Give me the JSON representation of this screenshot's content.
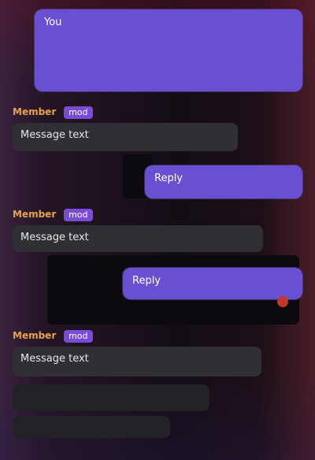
{
  "messages": [
    {
      "type": "outgoing",
      "text": "You"
    },
    {
      "type": "incoming",
      "author": "Member",
      "tag": "mod",
      "text": "Message text"
    },
    {
      "type": "outgoing",
      "text": "Reply"
    },
    {
      "type": "incoming",
      "author": "Member",
      "tag": "mod",
      "text": "Message text"
    },
    {
      "type": "outgoing",
      "text": "Reply"
    },
    {
      "type": "incoming",
      "author": "Member",
      "tag": "mod",
      "text": "Message text"
    }
  ],
  "input": {
    "placeholder": ""
  },
  "colors": {
    "outgoing_bubble": "#6a4fd0",
    "incoming_bubble": "#2f2f35",
    "author_name": "#e8a24a",
    "tag": "#7a4bd6",
    "background": "#140d16"
  }
}
